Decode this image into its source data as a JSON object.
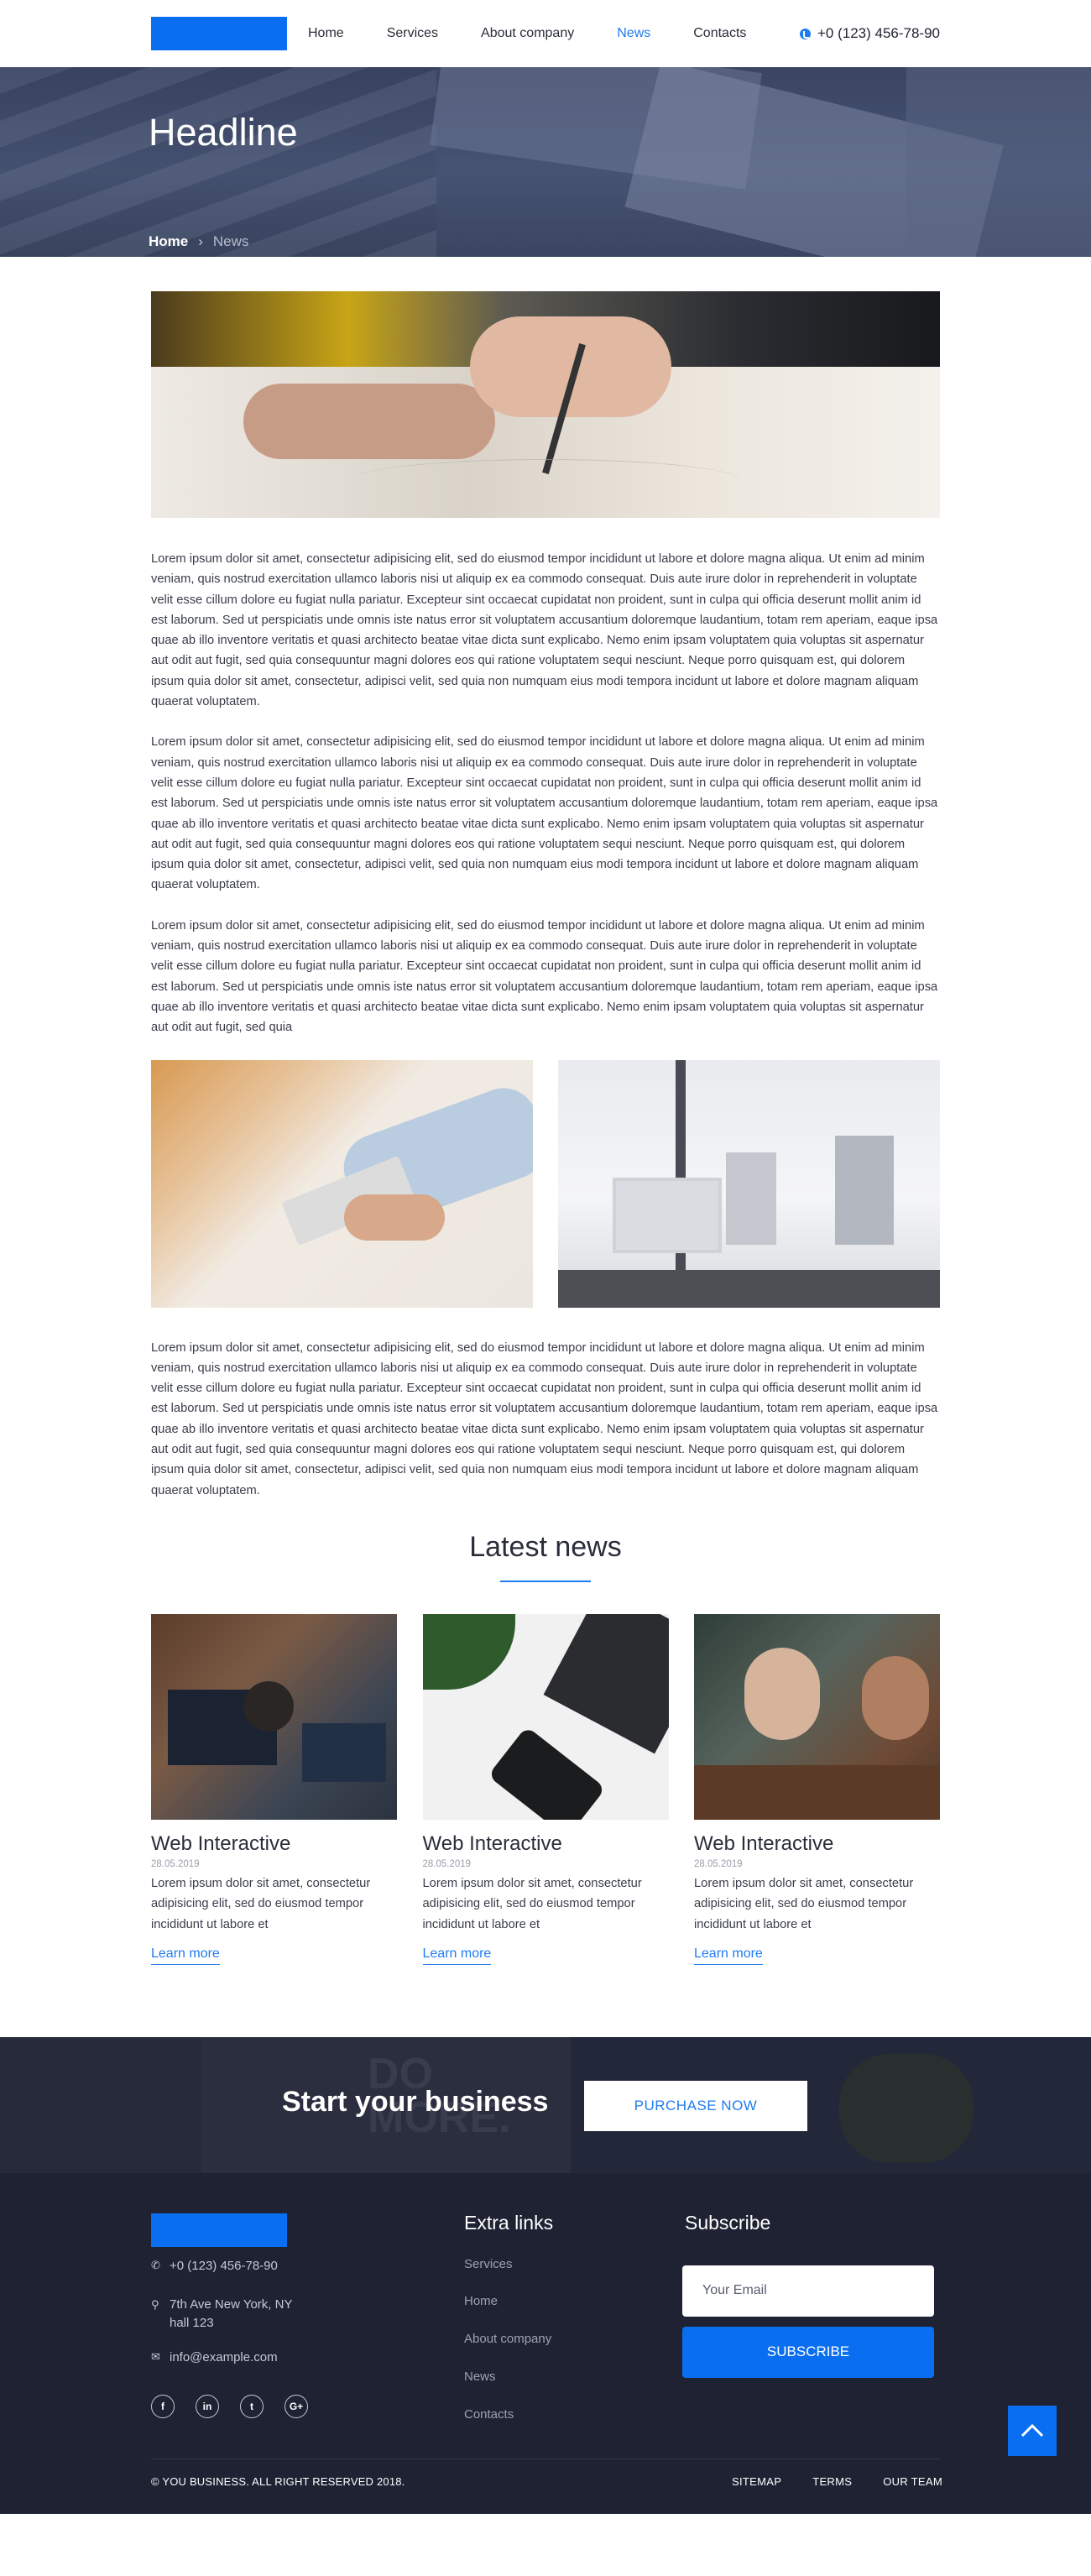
{
  "nav": {
    "items": [
      {
        "label": "Home"
      },
      {
        "label": "Services"
      },
      {
        "label": "About company"
      },
      {
        "label": "News"
      },
      {
        "label": "Contacts"
      }
    ],
    "active": "News",
    "phone": "+0 (123) 456-78-90"
  },
  "hero": {
    "title": "Headline",
    "breadcrumb_home": "Home",
    "breadcrumb_current": "News"
  },
  "article": {
    "paragraphs": [
      "Lorem ipsum dolor sit amet, consectetur adipisicing elit, sed do eiusmod tempor incididunt ut labore et dolore magna aliqua. Ut enim ad minim veniam, quis nostrud exercitation ullamco laboris nisi ut aliquip ex ea commodo consequat. Duis aute irure dolor in reprehenderit in voluptate velit esse cillum dolore eu fugiat nulla pariatur. Excepteur sint occaecat cupidatat non proident, sunt in culpa qui officia deserunt mollit anim id est laborum. Sed ut perspiciatis unde omnis iste natus error sit voluptatem accusantium doloremque laudantium, totam rem aperiam, eaque ipsa quae ab illo inventore veritatis et quasi architecto beatae vitae dicta sunt explicabo. Nemo enim ipsam voluptatem quia voluptas sit aspernatur aut odit aut fugit, sed quia consequuntur magni dolores eos qui ratione voluptatem sequi nesciunt. Neque porro quisquam est, qui dolorem ipsum quia dolor sit amet, consectetur, adipisci velit, sed quia non numquam eius modi tempora incidunt ut labore et dolore magnam aliquam quaerat voluptatem.",
      "Lorem ipsum dolor sit amet, consectetur adipisicing elit, sed do eiusmod tempor incididunt ut labore et dolore magna aliqua. Ut enim ad minim veniam, quis nostrud exercitation ullamco laboris nisi ut aliquip ex ea commodo consequat. Duis aute irure dolor in reprehenderit in voluptate velit esse cillum dolore eu fugiat nulla pariatur. Excepteur sint occaecat cupidatat non proident, sunt in culpa qui officia deserunt mollit anim id est laborum. Sed ut perspiciatis unde omnis iste natus error sit voluptatem accusantium doloremque laudantium, totam rem aperiam, eaque ipsa quae ab illo inventore veritatis et quasi architecto beatae vitae dicta sunt explicabo. Nemo enim ipsam voluptatem quia voluptas sit aspernatur aut odit aut fugit, sed quia consequuntur magni dolores eos qui ratione voluptatem sequi nesciunt. Neque porro quisquam est, qui dolorem ipsum quia dolor sit amet, consectetur, adipisci velit, sed quia non numquam eius modi tempora incidunt ut labore et dolore magnam aliquam quaerat voluptatem.",
      "Lorem ipsum dolor sit amet, consectetur adipisicing elit, sed do eiusmod tempor incididunt ut labore et dolore magna aliqua. Ut enim ad minim veniam, quis nostrud exercitation ullamco laboris nisi ut aliquip ex ea commodo consequat. Duis aute irure dolor in reprehenderit in voluptate velit esse cillum dolore eu fugiat nulla pariatur. Excepteur sint occaecat cupidatat non proident, sunt in culpa qui officia deserunt mollit anim id est laborum. Sed ut perspiciatis unde omnis iste natus error sit voluptatem accusantium doloremque laudantium, totam rem aperiam, eaque ipsa quae ab illo inventore veritatis et quasi architecto beatae vitae dicta sunt explicabo. Nemo enim ipsam voluptatem quia voluptas sit aspernatur aut odit aut fugit, sed quia",
      "Lorem ipsum dolor sit amet, consectetur adipisicing elit, sed do eiusmod tempor incididunt ut labore et dolore magna aliqua. Ut enim ad minim veniam, quis nostrud exercitation ullamco laboris nisi ut aliquip ex ea commodo consequat. Duis aute irure dolor in reprehenderit in voluptate velit esse cillum dolore eu fugiat nulla pariatur. Excepteur sint occaecat cupidatat non proident, sunt in culpa qui officia deserunt mollit anim id est laborum. Sed ut perspiciatis unde omnis iste natus error sit voluptatem accusantium doloremque laudantium, totam rem aperiam, eaque ipsa quae ab illo inventore veritatis et quasi architecto beatae vitae dicta sunt explicabo. Nemo enim ipsam voluptatem quia voluptas sit aspernatur aut odit aut fugit, sed quia consequuntur magni dolores eos qui ratione voluptatem sequi nesciunt. Neque porro quisquam est, qui dolorem ipsum quia dolor sit amet, consectetur, adipisci velit, sed quia non numquam eius modi tempora incidunt ut labore et dolore magnam aliquam quaerat voluptatem."
    ]
  },
  "latest": {
    "title": "Latest news",
    "cards": [
      {
        "title": "Web Interactive",
        "date": "28.05.2019",
        "excerpt": "Lorem ipsum dolor sit amet, consectetur adipisicing elit, sed do eiusmod tempor incididunt ut labore et",
        "link": "Learn more"
      },
      {
        "title": "Web Interactive",
        "date": "28.05.2019",
        "excerpt": "Lorem ipsum dolor sit amet, consectetur adipisicing elit, sed do eiusmod tempor incididunt ut labore et",
        "link": "Learn more"
      },
      {
        "title": "Web Interactive",
        "date": "28.05.2019",
        "excerpt": "Lorem ipsum dolor sit amet, consectetur adipisicing elit, sed do eiusmod tempor incididunt ut labore et",
        "link": "Learn more"
      }
    ]
  },
  "cta": {
    "title": "Start your business",
    "button": "PURCHASE NOW",
    "bg_text_1": "DO",
    "bg_text_2": "MORE."
  },
  "footer": {
    "phone": "+0 (123) 456-78-90",
    "address": "7th Ave New York, NY hall 123",
    "email": "info@example.com",
    "socials": [
      "facebook-icon",
      "linkedin-icon",
      "twitter-icon",
      "google-plus-icon"
    ],
    "extra_title": "Extra links",
    "links": [
      "Services",
      "Home",
      "About company",
      "News",
      "Contacts"
    ],
    "subscribe_title": "Subscribe",
    "email_placeholder": "Your Email",
    "subscribe_button": "SUBSCRIBE",
    "copyright": "© YOU BUSINESS. ALL RIGHT RESERVED 2018.",
    "legal": [
      "SITEMAP",
      "TERMS",
      "OUR TEAM"
    ]
  },
  "colors": {
    "accent": "#0a6ef0",
    "footer_bg": "#1e2233",
    "hero_bg": "#404b6a"
  }
}
